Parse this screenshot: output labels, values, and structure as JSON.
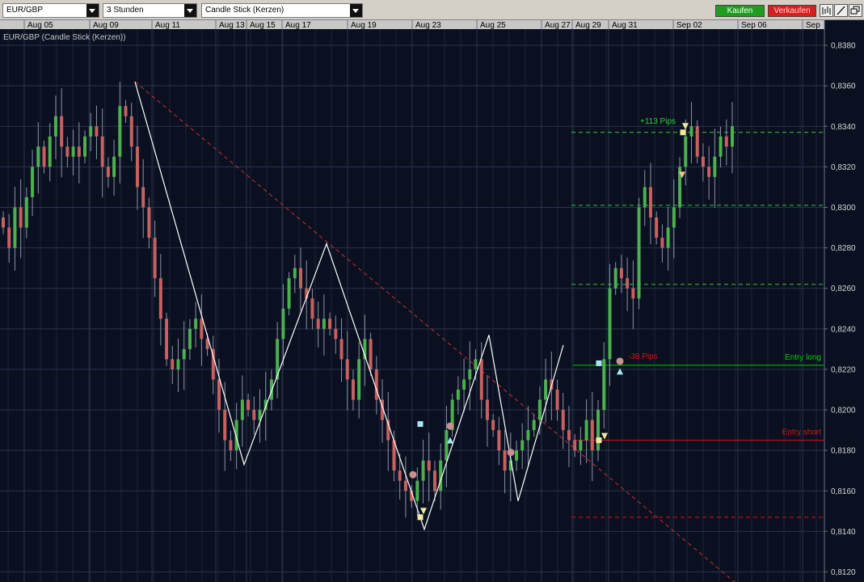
{
  "toolbar": {
    "symbol": "EUR/GBP",
    "timeframe": "3 Stunden",
    "chart_type": "Candle Stick (Kerzen)",
    "buy_label": "Kaufen",
    "sell_label": "Verkaufen",
    "icons": [
      "bar-chart-icon",
      "draw-line-icon",
      "window-restore-icon"
    ]
  },
  "chart_data": {
    "type": "candlestick",
    "title": "EUR/GBP (Candle Stick (Kerzen))",
    "x_tick_labels": [
      "Aug 05",
      "Aug 09",
      "Aug 11",
      "Aug 13",
      "Aug 15",
      "Aug 17",
      "Aug 19",
      "Aug 23",
      "Aug 25",
      "Aug 27",
      "Aug 29",
      "Aug 31",
      "Sep 02",
      "Sep 06",
      "Sep"
    ],
    "y_tick_labels": [
      "0,8380",
      "0,8360",
      "0,8340",
      "0,8320",
      "0,8300",
      "0,8280",
      "0,8260",
      "0,8240",
      "0,8220",
      "0,8200",
      "0,8180",
      "0,8160",
      "0,8140",
      "0,8120"
    ],
    "ylim": [
      0.8115,
      0.8388
    ],
    "grid": true,
    "price_series": [
      0.829,
      0.828,
      0.83,
      0.829,
      0.8305,
      0.832,
      0.833,
      0.832,
      0.8335,
      0.8345,
      0.833,
      0.8325,
      0.833,
      0.8325,
      0.8335,
      0.834,
      0.8335,
      0.832,
      0.8315,
      0.8325,
      0.835,
      0.8345,
      0.833,
      0.831,
      0.83,
      0.8285,
      0.8265,
      0.8245,
      0.8225,
      0.822,
      0.8225,
      0.823,
      0.824,
      0.8245,
      0.8235,
      0.823,
      0.8215,
      0.82,
      0.8185,
      0.818,
      0.8195,
      0.8205,
      0.82,
      0.8195,
      0.82,
      0.8205,
      0.8215,
      0.8235,
      0.825,
      0.8265,
      0.827,
      0.826,
      0.8255,
      0.8245,
      0.824,
      0.8245,
      0.824,
      0.8235,
      0.8225,
      0.8215,
      0.8205,
      0.8225,
      0.8235,
      0.822,
      0.8205,
      0.8195,
      0.8185,
      0.817,
      0.8165,
      0.816,
      0.8155,
      0.8165,
      0.8175,
      0.817,
      0.816,
      0.8175,
      0.819,
      0.8205,
      0.821,
      0.8215,
      0.822,
      0.8225,
      0.8205,
      0.8195,
      0.819,
      0.818,
      0.817,
      0.8175,
      0.818,
      0.8185,
      0.819,
      0.8195,
      0.8205,
      0.8215,
      0.821,
      0.82,
      0.819,
      0.8185,
      0.818,
      0.8185,
      0.8195,
      0.818,
      0.82,
      0.8225,
      0.826,
      0.827,
      0.8265,
      0.826,
      0.8255,
      0.83,
      0.831,
      0.8295,
      0.8285,
      0.828,
      0.829,
      0.83,
      0.832,
      0.8335,
      0.834,
      0.8325,
      0.832,
      0.8315,
      0.8325,
      0.8335,
      0.833,
      0.834
    ],
    "trend_line": {
      "from": {
        "date": "Aug 09",
        "price": 0.8362
      },
      "to": {
        "date": "Sep 06",
        "price": 0.8115
      },
      "style": "dashed",
      "color": "#c83232"
    },
    "zigzag": [
      {
        "date": "Aug 09",
        "price": 0.8362
      },
      {
        "date": "Aug 13",
        "price": 0.8173
      },
      {
        "date": "Aug 17",
        "price": 0.8282
      },
      {
        "date": "Aug 23",
        "price": 0.8141
      },
      {
        "date": "Aug 25",
        "price": 0.8237
      },
      {
        "date": "Aug 27",
        "price": 0.8155
      },
      {
        "date": "Aug 28",
        "price": 0.8232
      }
    ],
    "levels": [
      {
        "label": "Entry long",
        "price": 0.8222,
        "color": "#00c800",
        "style": "solid"
      },
      {
        "label": "Entry short",
        "price": 0.8185,
        "color": "#e01010",
        "style": "solid"
      },
      {
        "label": "+113 Pips",
        "price": 0.8337,
        "color": "#32d232",
        "style": "dashed"
      },
      {
        "label": "",
        "price": 0.8301,
        "color": "#32c832",
        "style": "dashed"
      },
      {
        "label": "",
        "price": 0.8262,
        "color": "#32c832",
        "style": "dashed"
      },
      {
        "label": "-38 Pips",
        "price": 0.8147,
        "color": "#e01010",
        "style": "dashed"
      }
    ],
    "colors": {
      "background": "#0a1020",
      "bull": "#4caf50",
      "bear": "#c86060",
      "zigzag": "#ffffff",
      "grid": "#28334d"
    }
  }
}
